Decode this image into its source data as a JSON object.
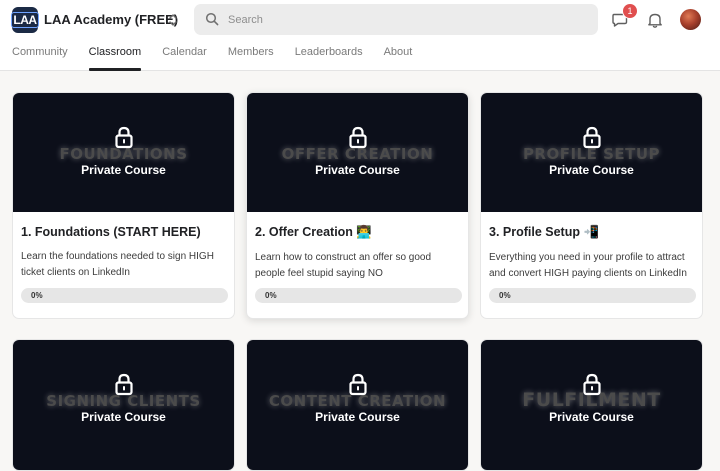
{
  "header": {
    "logo_text": "LAA",
    "group_name": "LAA Academy (FREE)",
    "search_placeholder": "Search",
    "chat_badge": "1",
    "icons": [
      "search-icon",
      "chat-icon",
      "bell-icon",
      "chevron-updown-icon"
    ]
  },
  "tabs": [
    {
      "label": "Community",
      "active": false
    },
    {
      "label": "Classroom",
      "active": true
    },
    {
      "label": "Calendar",
      "active": false
    },
    {
      "label": "Members",
      "active": false
    },
    {
      "label": "Leaderboards",
      "active": false
    },
    {
      "label": "About",
      "active": false
    }
  ],
  "courses": [
    {
      "cover_title": "FOUNDATIONS",
      "private_label": "Private Course",
      "title": "1. Foundations (START HERE)",
      "description": "Learn the foundations needed to sign HIGH ticket clients on LinkedIn",
      "progress_label": "0%",
      "progress": 0
    },
    {
      "cover_title": "OFFER CREATION",
      "private_label": "Private Course",
      "title": "2. Offer Creation 👨‍💻",
      "description": "Learn how to construct an offer so good people feel stupid saying NO",
      "progress_label": "0%",
      "progress": 0
    },
    {
      "cover_title": "PROFILE SETUP",
      "private_label": "Private Course",
      "title": "3. Profile Setup 📲",
      "description": "Everything you need in your profile to attract and convert HIGH paying clients on LinkedIn",
      "progress_label": "0%",
      "progress": 0
    },
    {
      "cover_title": "SIGNING CLIENTS",
      "private_label": "Private Course"
    },
    {
      "cover_title": "CONTENT CREATION",
      "private_label": "Private Course"
    },
    {
      "cover_title": "FULFILMENT",
      "private_label": "Private Course"
    }
  ],
  "colors": {
    "cover_bg": "#0c0f1a",
    "badge": "#e04f4f",
    "brand": "#1b2a45"
  }
}
